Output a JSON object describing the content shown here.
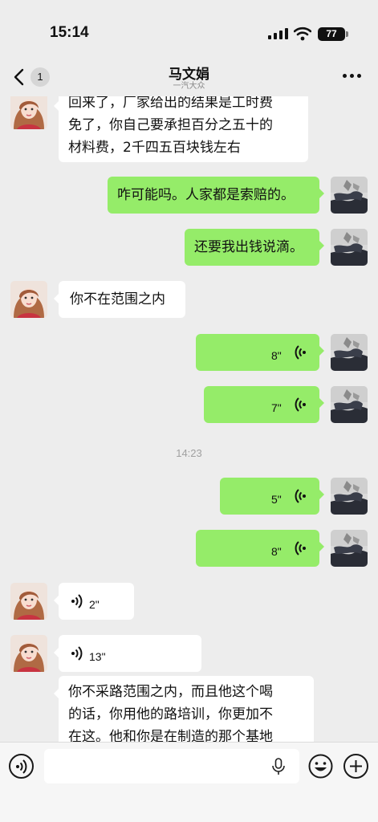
{
  "status_bar": {
    "time": "15:14",
    "battery": "77"
  },
  "header": {
    "unread_count": "1",
    "title": "马文娟",
    "subtitle": "一汽大众"
  },
  "messages": {
    "m1": {
      "lines": [
        "回来了，厂家给出的结果是工时费",
        "免了，你自己要承担百分之五十的",
        "材料费，2千四五百块钱左右"
      ]
    },
    "m2": {
      "text": "咋可能吗。人家都是索赔的。"
    },
    "m3": {
      "text": "还要我出钱说滴。"
    },
    "m4": {
      "text": "你不在范围之内"
    },
    "m5": {
      "duration": "8\""
    },
    "m6": {
      "duration": "7\""
    },
    "m7": {
      "duration": "5\""
    },
    "m8": {
      "duration": "8\""
    },
    "m9": {
      "duration": "2\""
    },
    "m10": {
      "duration": "13\""
    },
    "m11": {
      "lines": [
        "你不采路范围之内，而且他这个喝",
        "的话，你用他的路培训，你更加不",
        "在这。他和你是在制造的那个基地"
      ]
    }
  },
  "time_divider": "14:23",
  "colors": {
    "outgoing_bubble": "#95ec69",
    "incoming_bubble": "#ffffff",
    "background": "#ededed"
  },
  "icons": [
    "back-icon",
    "more-icon",
    "voice-icon",
    "mic-icon",
    "emoji-icon",
    "plus-icon",
    "signal-icon",
    "wifi-icon",
    "battery-icon"
  ]
}
